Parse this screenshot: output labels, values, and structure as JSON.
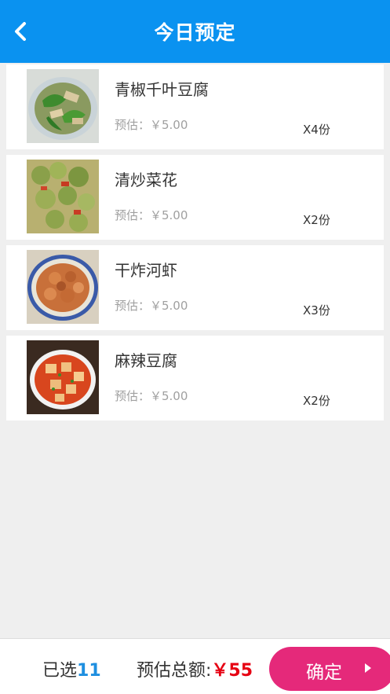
{
  "header": {
    "title": "今日预定",
    "back_icon": "chevron-left-icon"
  },
  "items": [
    {
      "name": "青椒千叶豆腐",
      "price": "预估：￥5.00",
      "qty": "X4份",
      "image": "green-pepper-tofu-dish"
    },
    {
      "name": "清炒菜花",
      "price": "预估：￥5.00",
      "qty": "X2份",
      "image": "stir-fried-cauliflower-dish"
    },
    {
      "name": "干炸河虾",
      "price": "预估：￥5.00",
      "qty": "X3份",
      "image": "fried-river-shrimp-dish"
    },
    {
      "name": "麻辣豆腐",
      "price": "预估：￥5.00",
      "qty": "X2份",
      "image": "mapo-tofu-dish"
    }
  ],
  "footer": {
    "selected_label": "已选",
    "selected_count": "11",
    "total_label": "预估总额:",
    "total_amount": "￥55",
    "confirm_label": "确定",
    "confirm_icon": "caret-right-icon"
  },
  "colors": {
    "header_bg": "#0a92f0",
    "count": "#1e8fe0",
    "amount": "#e60012",
    "confirm_bg": "#e5297a"
  }
}
